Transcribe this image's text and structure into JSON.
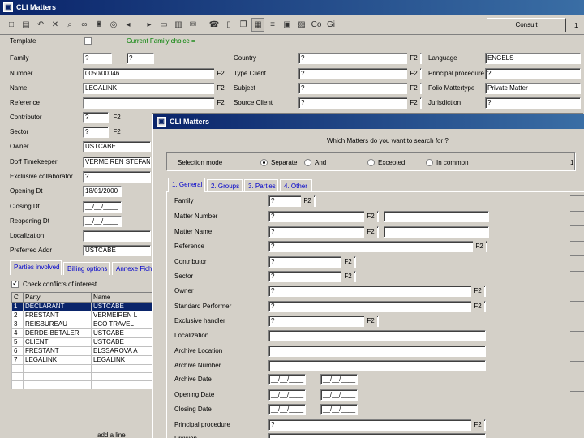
{
  "back_window": {
    "title": "CLI Matters",
    "consult_label": "Consult",
    "top_right_value": "1",
    "toolbar_icons": [
      "new-icon",
      "save-icon",
      "undo-icon",
      "delete-icon",
      "search-icon",
      "binoculars-icon",
      "stamp-icon",
      "globe-icon",
      "back-arrow-icon",
      "forward-arrow-icon",
      "folder-icon",
      "print-icon",
      "mail-icon",
      "phone-icon",
      "book-icon",
      "copy-icon",
      "grid-icon",
      "list-icon",
      "calendar-icon",
      "chart-icon",
      "copy-label-icon",
      "gi-icon"
    ],
    "toolbar_text_copy": "Co",
    "toolbar_text_gi": "Gi",
    "template_label": "Template",
    "current_family_label": "Current Family choice =",
    "left_fields": [
      {
        "label": "Family",
        "value": "?"
      },
      {
        "label": "Number",
        "value": "0050/00046"
      },
      {
        "label": "Name",
        "value": "LEGALINK"
      },
      {
        "label": "Reference",
        "value": ""
      },
      {
        "label": "Contributor",
        "value": "?"
      },
      {
        "label": "Sector",
        "value": "?"
      },
      {
        "label": "Owner",
        "value": "USTCABE"
      },
      {
        "label": "Doff Timekeeper",
        "value": "VERMEIREN STEFAN"
      },
      {
        "label": "Exclusive collaborator",
        "value": "?"
      },
      {
        "label": "Opening Dt",
        "value": "18/01/2000"
      },
      {
        "label": "Closing Dt",
        "value": "__/__/____"
      },
      {
        "label": "Reopening Dt",
        "value": "__/__/____"
      },
      {
        "label": "Localization",
        "value": ""
      },
      {
        "label": "Preferred Addr",
        "value": "USTCABE"
      }
    ],
    "family_extra": "?",
    "mid_fields": [
      {
        "label": "Country",
        "value": "?"
      },
      {
        "label": "Type Client",
        "value": "?"
      },
      {
        "label": "Subject",
        "value": "?"
      },
      {
        "label": "Source Client",
        "value": "?"
      }
    ],
    "right_fields": [
      {
        "label": "Language",
        "value": "ENGELS"
      },
      {
        "label": "Principal procedure",
        "value": "?"
      },
      {
        "label": "Folio Mattertype",
        "value": "Private Matter"
      },
      {
        "label": "Jurisdiction",
        "value": "?"
      }
    ],
    "f2": "F2",
    "bottom_tabs": [
      "Parties involved",
      "Billing options",
      "Annexe Fiche"
    ],
    "check_conflicts_label": "Check conflicts of interest",
    "parties_columns": [
      "Cl",
      "Party",
      "Name"
    ],
    "parties_rows": [
      {
        "n": "1",
        "party": "DECLARANT",
        "name": "USTCABE"
      },
      {
        "n": "2",
        "party": "FRESTANT",
        "name": "VERMEIREN L"
      },
      {
        "n": "3",
        "party": "REISBUREAU",
        "name": "ECO TRAVEL"
      },
      {
        "n": "4",
        "party": "DERDE-BETALER",
        "name": "USTCABE"
      },
      {
        "n": "5",
        "party": "CLIENT",
        "name": "USTCABE"
      },
      {
        "n": "6",
        "party": "FRESTANT",
        "name": "ELSSAROVA A"
      },
      {
        "n": "7",
        "party": "LEGALINK",
        "name": "LEGALINK"
      }
    ],
    "add_line_label": "add a line"
  },
  "front_window": {
    "title": "CLI Matters",
    "question": "Which Matters do you want to search for ?",
    "selection_label": "Selection mode",
    "radio_options": [
      "Separate",
      "And",
      "Excepted",
      "In common"
    ],
    "selected_radio": 0,
    "selection_count": "1",
    "tabs": [
      "1. General",
      "2. Groups",
      "3. Parties",
      "4. Other"
    ],
    "fields": [
      {
        "label": "Family",
        "value": "?",
        "f2": true,
        "w": 58,
        "extra": false
      },
      {
        "label": "Matter Number",
        "value": "?",
        "f2": true,
        "w": 136,
        "extra": true
      },
      {
        "label": "Matter Name",
        "value": "?",
        "f2": true,
        "w": 136,
        "extra": true
      },
      {
        "label": "Reference",
        "value": "?",
        "f2": true,
        "w": 270,
        "extra": false
      },
      {
        "label": "Contributor",
        "value": "?",
        "f2": true,
        "w": 108,
        "extra": false
      },
      {
        "label": "Sector",
        "value": "?",
        "f2": true,
        "w": 108,
        "extra": false
      },
      {
        "label": "Owner",
        "value": "?",
        "f2": true,
        "w": 268,
        "extra": false
      },
      {
        "label": "Standard Performer",
        "value": "?",
        "f2": true,
        "w": 268,
        "extra": false
      },
      {
        "label": "Exclusive handler",
        "value": "?",
        "f2": true,
        "w": 136,
        "extra": false
      },
      {
        "label": "Localization",
        "value": "",
        "f2": false,
        "w": 268,
        "extra": false
      },
      {
        "label": "Archive Location",
        "value": "",
        "f2": false,
        "w": 268,
        "extra": false
      },
      {
        "label": "Archive Number",
        "value": "",
        "f2": false,
        "w": 268,
        "extra": false
      },
      {
        "label": "Archive Date",
        "value": "__/__/____",
        "f2": false,
        "w": 46,
        "date2": "__/__/____"
      },
      {
        "label": "Opening Date",
        "value": "__/__/____",
        "f2": false,
        "w": 46,
        "date2": "__/__/____"
      },
      {
        "label": "Closing Date",
        "value": "__/__/____",
        "f2": false,
        "w": 46,
        "date2": "__/__/____"
      },
      {
        "label": "Principal procedure",
        "value": "?",
        "f2": true,
        "w": 268,
        "extra": false
      },
      {
        "label": "Division",
        "value": "",
        "f2": false,
        "w": 268,
        "extra": false
      }
    ]
  }
}
